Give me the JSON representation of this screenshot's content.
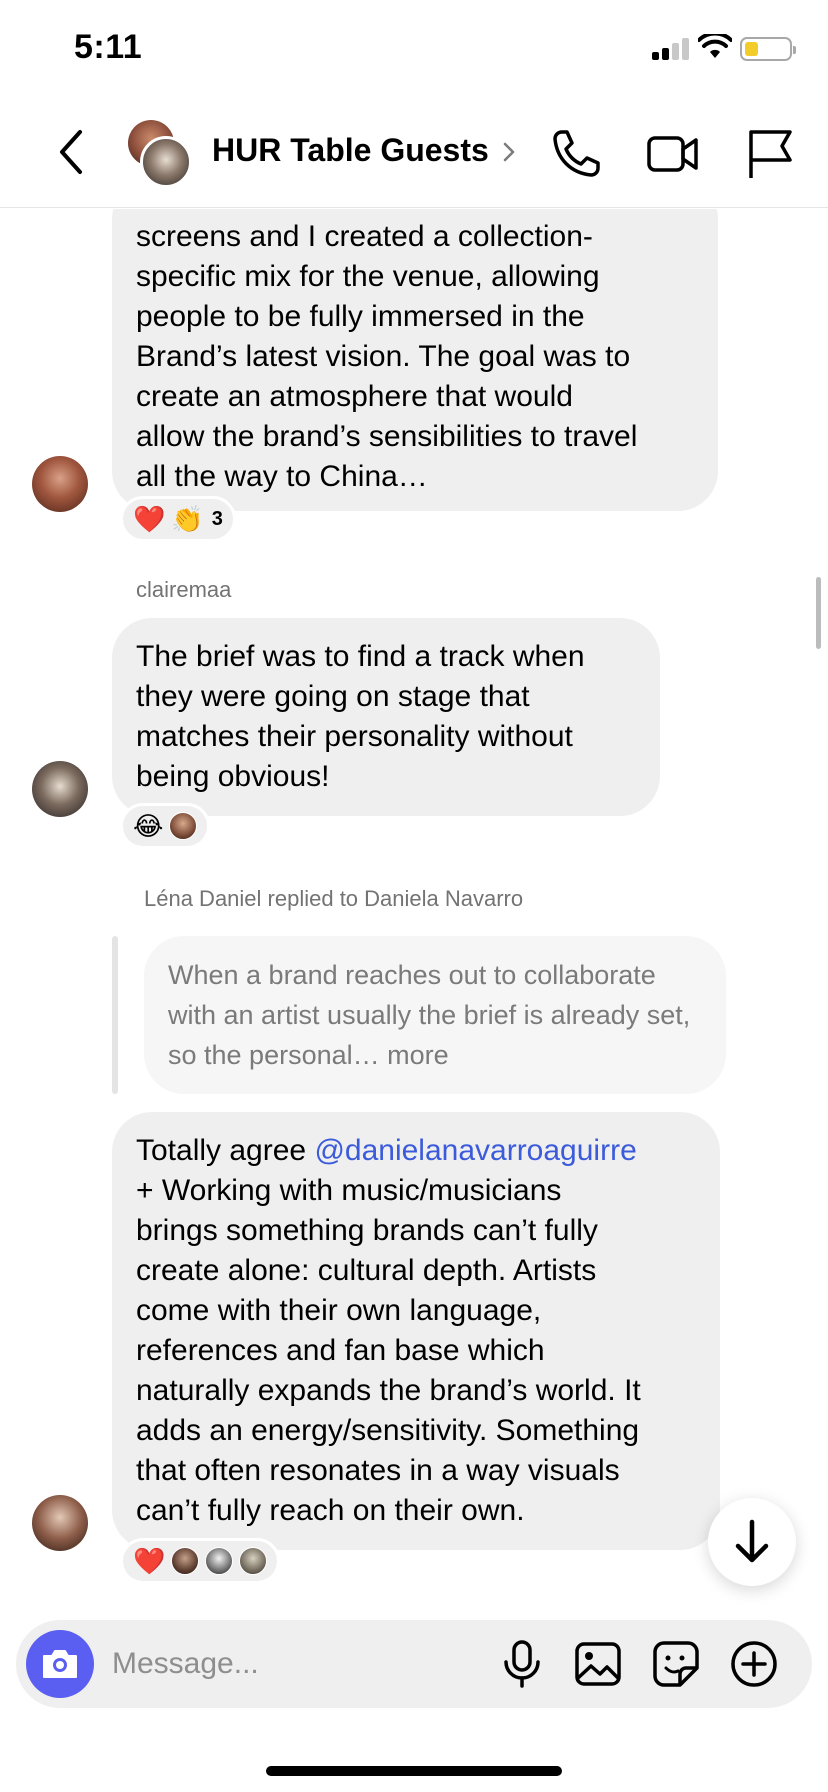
{
  "status_bar": {
    "time": "5:11"
  },
  "header": {
    "title": "HUR Table Guests"
  },
  "messages": [
    {
      "lines": [
        "screens and I created a collection-",
        "specific mix for the venue, allowing",
        "people to be fully immersed in the",
        "Brand’s latest vision. The goal was to",
        "create an atmosphere that would",
        "allow the brand’s sensibilities to travel",
        "all the way to China…"
      ],
      "reactions": {
        "emojis": [
          "❤️",
          "👏"
        ],
        "count": "3"
      }
    },
    {
      "sender": "clairemaa",
      "lines": [
        "The brief was to find a track when",
        "they were going on stage that",
        "matches their personality without",
        "being obvious!"
      ],
      "reactions": {
        "emojis": [
          "😂"
        ]
      }
    },
    {
      "reply_note": "Léna Daniel replied to Daniela Navarro",
      "quoted_lines": [
        "When a brand reaches out to collaborate",
        "with an artist usually the brief is already",
        "set, so the personal… more"
      ],
      "mention": "@danielanavarroaguirre",
      "first_line_prefix": "Totally agree ",
      "lines": [
        "+ Working with music/musicians",
        "brings something brands can’t fully",
        "create alone: cultural depth. Artists",
        "come with their own language,",
        "references and fan base which",
        "naturally expands the brand’s world. It",
        "adds an energy/sensitivity. Something",
        "that often resonates in a way visuals",
        "can’t fully reach on their own."
      ],
      "reactions": {
        "emojis": [
          "❤️"
        ]
      }
    }
  ],
  "composer": {
    "placeholder": "Message..."
  },
  "colors": {
    "accent": "#5b5ff1",
    "mention": "#3b5bdb",
    "bubble": "#efefef"
  },
  "icons": [
    "chevron-left-icon",
    "phone-icon",
    "video-camera-icon",
    "flag-icon",
    "camera-icon",
    "microphone-icon",
    "image-icon",
    "sticker-icon",
    "plus-circle-icon",
    "arrow-down-icon"
  ]
}
